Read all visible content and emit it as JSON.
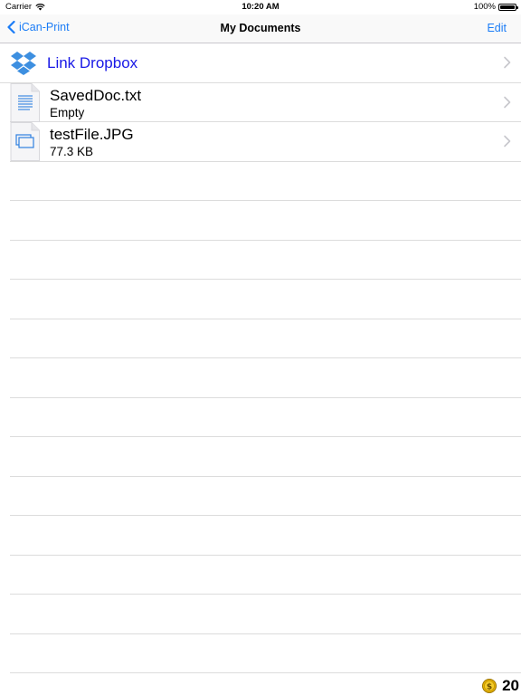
{
  "status_bar": {
    "carrier": "Carrier",
    "time": "10:20 AM",
    "battery": "100%",
    "battery_level": 1.0
  },
  "nav": {
    "back_label": "iCan-Print",
    "title": "My Documents",
    "edit_label": "Edit"
  },
  "list": {
    "dropbox_label": "Link Dropbox",
    "files": [
      {
        "name": "SavedDoc.txt",
        "detail": "Empty",
        "icon": "text-document-icon"
      },
      {
        "name": "testFile.JPG",
        "detail": "77.3 KB",
        "icon": "image-document-icon"
      }
    ]
  },
  "coins": {
    "icon": "dollar-coin-icon",
    "count": "20"
  },
  "colors": {
    "accent": "#1b7cf6",
    "dropbox_text": "#1919e6",
    "separator": "#dcdcdc"
  }
}
